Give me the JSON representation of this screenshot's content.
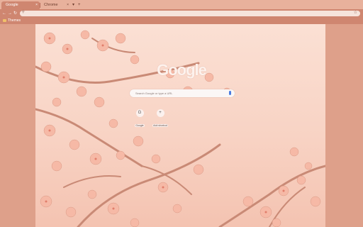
{
  "browser": {
    "tabs": [
      {
        "label": "Google",
        "active": true
      },
      {
        "label": "Chrome",
        "active": false
      }
    ],
    "tab_close_glyph": "×",
    "tab_menu_glyph": "▾",
    "new_tab_glyph": "+",
    "nav": {
      "back": "←",
      "forward": "→",
      "reload": "↻"
    },
    "omnibox": {
      "search_glyph": "⚲",
      "star_glyph": "☆",
      "value": ""
    },
    "bookmarks": [
      {
        "label": "Themes"
      }
    ]
  },
  "ntp": {
    "logo": "Google",
    "search_placeholder": "Search Google or type a URL",
    "shortcuts": [
      {
        "label": "Google",
        "icon": "G"
      },
      {
        "label": "Add shortcut",
        "icon": "+"
      }
    ]
  },
  "colors": {
    "frame": "#dea08a",
    "toolbar": "#cf8670",
    "tab_active": "#cf8670",
    "blossom": "#f6b9a6",
    "branch": "#c98a76"
  }
}
